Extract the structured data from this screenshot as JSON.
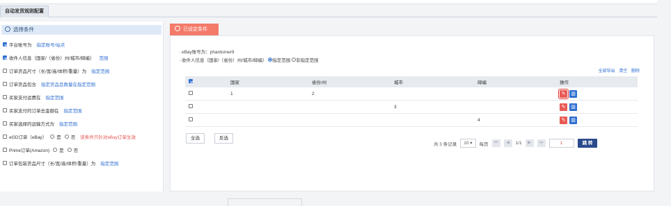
{
  "tab": {
    "label": "自动发货规则配置"
  },
  "left": {
    "header": "选择条件",
    "rows": [
      {
        "label": "平台账号为",
        "link": "指定账号/站点",
        "checked": true
      },
      {
        "label": "收件人信息（国家/（省份）州/城市/邮编）",
        "link": "范围",
        "checked": true
      },
      {
        "label": "订单货品尺寸（长/宽/高/体积/重量）为",
        "link": "指定范围",
        "checked": false
      },
      {
        "label": "订单货品包含",
        "link": "指定货品且数量在指定范围",
        "checked": false
      },
      {
        "label": "买家支付运费在",
        "link": "指定范围",
        "checked": false
      },
      {
        "label": "买家支付的订单总金额在",
        "link": "指定范围",
        "checked": false
      },
      {
        "label": "买家选择的运输方式为",
        "link": "指定范围",
        "checked": false
      }
    ],
    "egd": {
      "label": "eGD订单（eBay）",
      "yes": "是",
      "no": "否",
      "warning": "该条件只针对eBay订单生效"
    },
    "prime": {
      "label": "Prime订单(Amazon)",
      "yes": "是",
      "no": "否"
    },
    "pkg": {
      "label": "订单包装货品尺寸（长/宽/高/体积/重量）为",
      "link": "指定范围"
    }
  },
  "right": {
    "tab": "已设定条件",
    "cond1": "· eBay账号为：phantomer9",
    "cond2": "· 收件人信息（国家/（省份）州/城市/邮编）",
    "cond2_opt1": "指定范围",
    "cond2_opt2": "非指定范围",
    "actions": {
      "export": "全部导出",
      "clear": "清空",
      "delete": "删除"
    },
    "columns": [
      "国家",
      "省份/州",
      "城市",
      "邮编",
      "操作"
    ],
    "rows": [
      {
        "country": "1",
        "province": "2",
        "city": "",
        "zip": ""
      },
      {
        "country": "",
        "province": "",
        "city": "3",
        "zip": ""
      },
      {
        "country": "",
        "province": "",
        "city": "",
        "zip": "4"
      }
    ],
    "select_all": "全选",
    "invert": "反选",
    "pager": {
      "total": "共 3 条记录",
      "per_page": "10",
      "per_label": "每页",
      "page_info": "1/1",
      "page_input": "1",
      "go": "跳 转"
    }
  },
  "colors": {
    "accent": "#2f6fd1",
    "red_tab": "#f47a6a",
    "warning": "#e3524f",
    "go_button": "#2a4a8c"
  }
}
